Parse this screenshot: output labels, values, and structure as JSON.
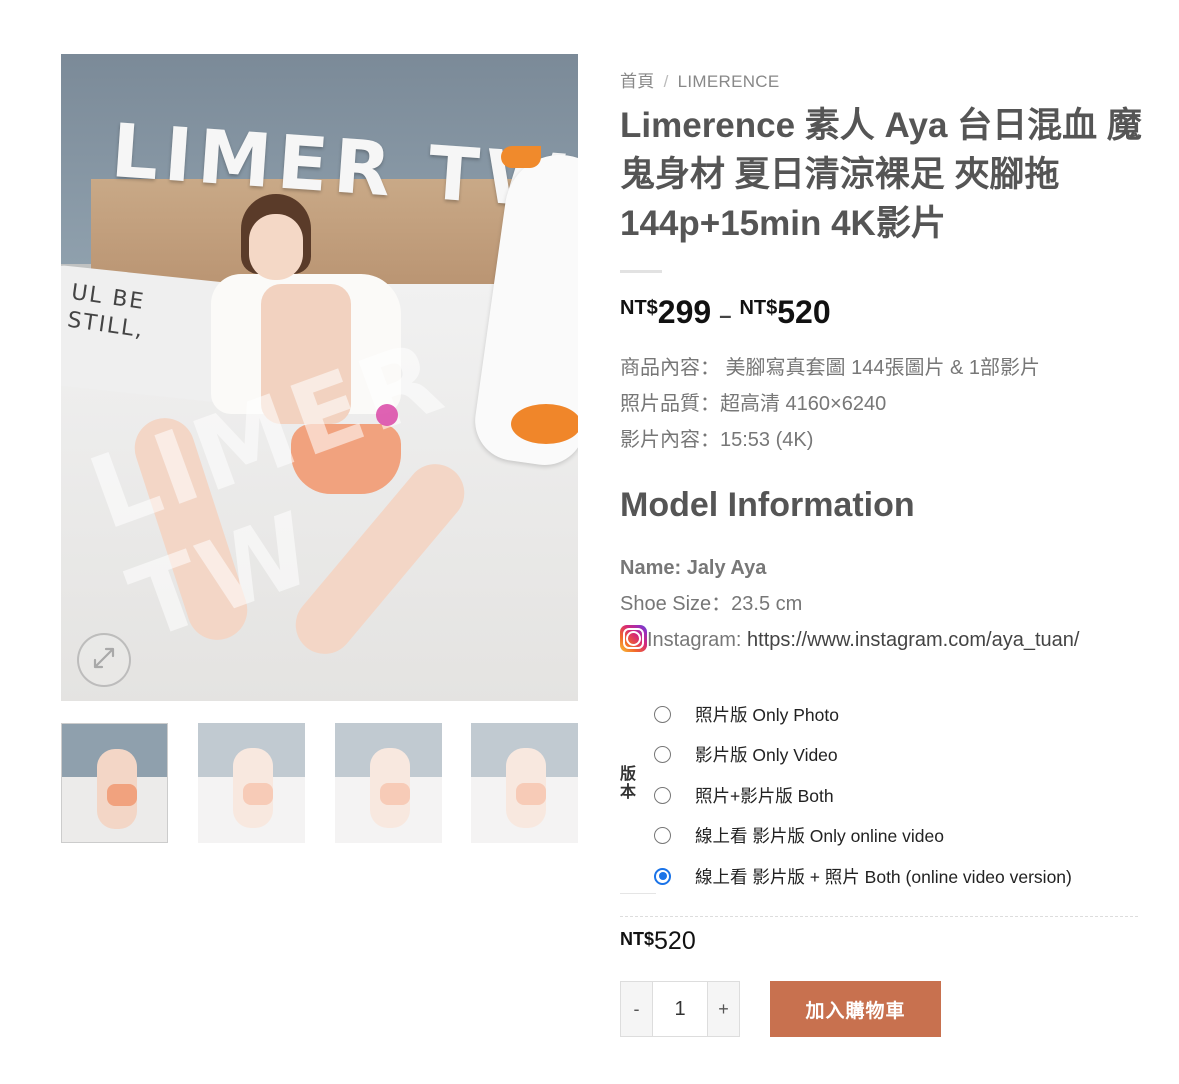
{
  "gallery": {
    "image_alt_text": "LIMER TW",
    "pillow_text": "UL BE\nSTILL,",
    "watermark_text": "LIMER TW",
    "thumbnail_count": 4
  },
  "breadcrumb": {
    "home": "首頁",
    "separator": "/",
    "category": "LIMERENCE"
  },
  "product": {
    "title": "Limerence 素人 Aya 台日混血 魔鬼身材 夏日清涼裸足 夾腳拖 144p+15min 4K影片",
    "price_min_currency": "NT$",
    "price_min": "299",
    "price_dash": "–",
    "price_max_currency": "NT$",
    "price_max": "520",
    "details": [
      "商品內容： 美腳寫真套圖 144張圖片 & 1部影片",
      "照片品質：超高清 4160×6240",
      "影片內容：15:53 (4K)"
    ]
  },
  "model": {
    "heading": "Model Information",
    "name_label": "Name: Jaly Aya",
    "shoe_size": "Shoe Size：23.5 cm",
    "instagram_label": "Instagram: ",
    "instagram_url": "https://www.instagram.com/aya_tuan/"
  },
  "variations": {
    "label": "版本",
    "selected_index": 4,
    "options": [
      "照片版 Only Photo",
      "影片版 Only Video",
      "照片+影片版 Both",
      "線上看 影片版 Only online video",
      "線上看 影片版 + 照片 Both (online video version)"
    ]
  },
  "selected_price": {
    "currency": "NT$",
    "amount": "520"
  },
  "cart": {
    "minus": "-",
    "plus": "+",
    "quantity": "1",
    "add_to_cart": "加入購物車"
  },
  "colors": {
    "accent_button": "#c8714f",
    "radio_selected": "#1a73e8"
  }
}
